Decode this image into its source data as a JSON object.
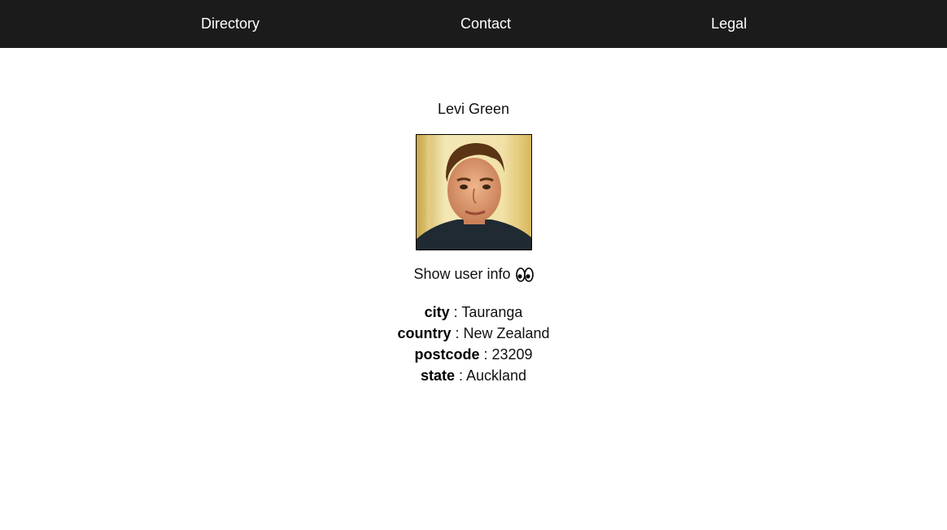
{
  "nav": {
    "items": [
      {
        "label": "Directory"
      },
      {
        "label": "Contact"
      },
      {
        "label": "Legal"
      }
    ]
  },
  "profile": {
    "name": "Levi Green",
    "toggle_label": "Show user info",
    "toggle_icon": "eyes-icon",
    "info": [
      {
        "key": "city",
        "value": "Tauranga"
      },
      {
        "key": "country",
        "value": "New Zealand"
      },
      {
        "key": "postcode",
        "value": "23209"
      },
      {
        "key": "state",
        "value": "Auckland"
      }
    ],
    "separator": " : "
  },
  "colors": {
    "navbar_bg": "#1b1b1b",
    "navbar_text": "#ffffff",
    "page_bg": "#ffffff"
  }
}
